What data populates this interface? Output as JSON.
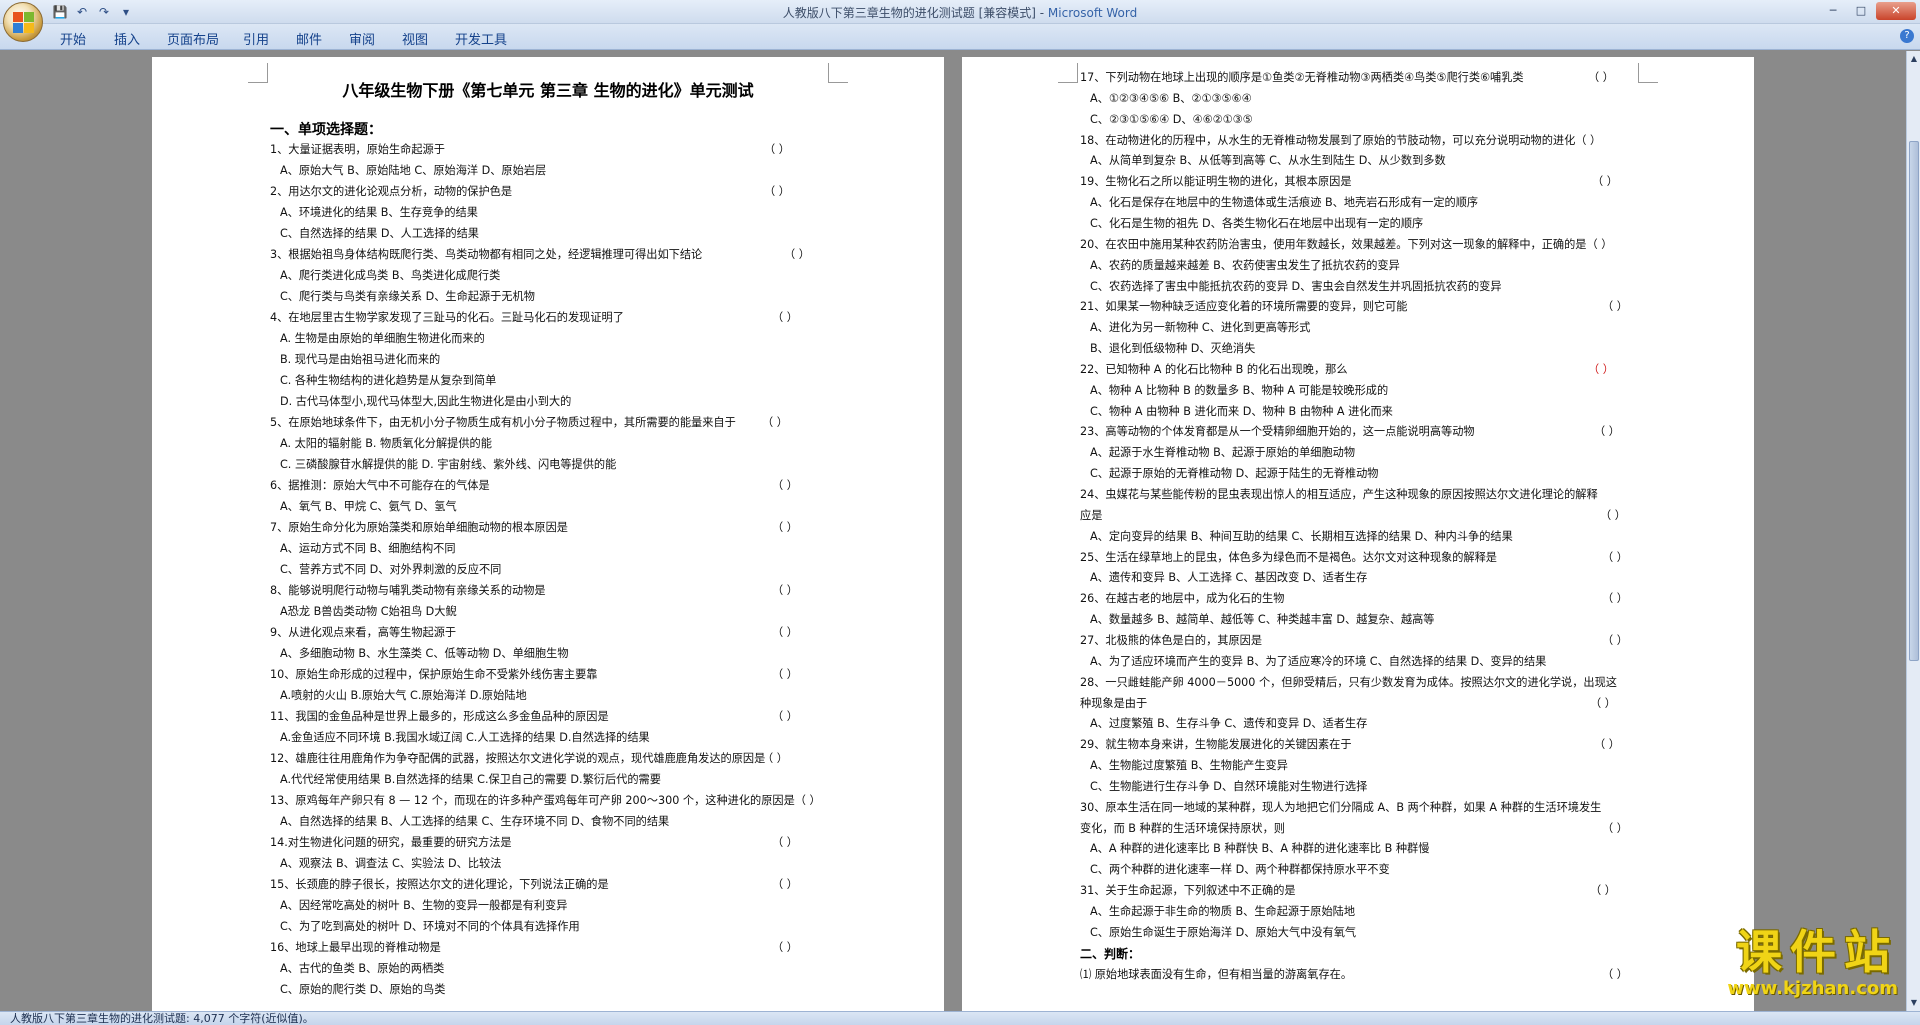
{
  "window": {
    "title_doc": "人教版八下第三章生物的进化测试题 [兼容模式] - ",
    "title_app": "Microsoft Word"
  },
  "quick_access": {
    "save": "💾",
    "undo": "↶",
    "redo": "↷",
    "more": "▾"
  },
  "window_controls": {
    "minimize": "─",
    "maximize": "□",
    "close": "✕"
  },
  "ribbon_tabs": [
    "开始",
    "插入",
    "页面布局",
    "引用",
    "邮件",
    "审阅",
    "视图",
    "开发工具"
  ],
  "help": "?",
  "left_page": {
    "title": "八年级生物下册《第七单元 第三章 生物的进化》单元测试",
    "section1": "一、单项选择题：",
    "lines": [
      "1、大量证据表明，原始生命起源于",
      "A、原始大气    B、原始陆地    C、原始海洋    D、原始岩层",
      "2、用达尔文的进化论观点分析，动物的保护色是",
      "A、环境进化的结果                B、生存竞争的结果",
      "C、自然选择的结果                D、人工选择的结果",
      "3、根据始祖鸟身体结构既爬行类、鸟类动物都有相同之处，经逻辑推理可得出如下结论",
      "A、爬行类进化成鸟类                B、鸟类进化成爬行类",
      "C、爬行类与鸟类有亲缘关系                D、生命起源于无机物",
      "4、在地层里古生物学家发现了三趾马的化石。三趾马化石的发现证明了",
      "A. 生物是由原始的单细胞生物进化而来的",
      "B. 现代马是由始祖马进化而来的",
      "C. 各种生物结构的进化趋势是从复杂到简单",
      "D. 古代马体型小,现代马体型大,因此生物进化是由小到大的",
      "5、在原始地球条件下，由无机小分子物质生成有机小分子物质过程中，其所需要的能量来自于",
      "A. 太阳的辐射能                B. 物质氧化分解提供的能",
      "C. 三磷酸腺苷水解提供的能                D. 宇宙射线、紫外线、闪电等提供的能",
      "6、据推测：原始大气中不可能存在的气体是",
      "A、氧气     B、甲烷     C、氨气     D、氢气",
      "7、原始生命分化为原始藻类和原始单细胞动物的根本原因是",
      "A、运动方式不同                B、细胞结构不同",
      "C、营养方式不同                D、对外界刺激的反应不同",
      "8、能够说明爬行动物与哺乳类动物有亲缘关系的动物是",
      "A恐龙      B兽齿类动物      C始祖鸟      D大鲵",
      "9、从进化观点来看，高等生物起源于",
      "A、多细胞动物        B、水生藻类        C、低等动物        D、单细胞生物",
      "10、原始生命形成的过程中，保护原始生命不受紫外线伤害主要靠",
      "A.喷射的火山      B.原始大气      C.原始海洋      D.原始陆地",
      "11、我国的金鱼品种是世界上最多的，形成这么多金鱼品种的原因是",
      "A.金鱼适应不同环境        B.我国水域辽阔        C.人工选择的结果        D.自然选择的结果",
      "12、雄鹿往往用鹿角作为争夺配偶的武器，按照达尔文进化学说的观点，现代雄鹿鹿角发达的原因是",
      "A.代代经常使用结果        B.自然选择的结果        C.保卫自己的需要        D.繁衍后代的需要",
      "13、原鸡每年产卵只有 8 — 12 个，而现在的许多种产蛋鸡每年可产卵 200～300 个，这种进化的原因是（   ）",
      "A、自然选择的结果      B、人工选择的结果      C、生存环境不同      D、食物不同的结果",
      "14.对生物进化问题的研究，最重要的研究方法是",
      "A、观察法        B、调查法        C、实验法        D、比较法",
      "15、长颈鹿的脖子很长，按照达尔文的进化理论，下列说法正确的是",
      "A、因经常吃高处的树叶                B、生物的变异一般都是有利变异",
      "C、为了吃到高处的树叶                D、环境对不同的个体具有选择作用",
      "16、地球上最早出现的脊椎动物是",
      "A、古代的鱼类                B、原始的两栖类",
      "C、原始的爬行类                D、原始的鸟类"
    ],
    "parens": [
      "（      ）",
      "（      ）",
      "（      ）",
      "（      ）",
      "（      ）",
      "（      ）",
      "（      ）",
      "（      ）",
      "（      ）",
      "（      ）",
      "（      ）",
      "（      ）",
      "（      ）",
      "（      ）",
      "（      ）"
    ]
  },
  "right_page": {
    "lines": [
      "17、下列动物在地球上出现的顺序是①鱼类②无脊椎动物③两栖类④鸟类⑤爬行类⑥哺乳类",
      "A、①②③④⑤⑥        B、②①③⑤⑥④",
      "C、②③①⑤⑥④        D、④⑥②①③⑤",
      "18、在动物进化的历程中，从水生的无脊椎动物发展到了原始的节肢动物，可以充分说明动物的进化（ ）",
      "A、从简单到复杂      B、从低等到高等      C、从水生到陆生      D、从少数到多数",
      "19、生物化石之所以能证明生物的进化，其根本原因是",
      "A、化石是保存在地层中的生物遗体或生活痕迹        B、地壳岩石形成有一定的顺序",
      "C、化石是生物的祖先                D、各类生物化石在地层中出现有一定的顺序",
      "20、在农田中施用某种农药防治害虫，使用年数越长，效果越差。下列对这一现象的解释中，正确的是（ ）",
      "A、农药的质量越来越差                B、农药使害虫发生了抵抗农药的变异",
      "C、农药选择了害虫中能抵抗农药的变异        D、害虫会自然发生并巩固抵抗农药的变异",
      "21、如果某一物种缺乏适应变化着的环境所需要的变异，则它可能",
      "A、进化为另一新物种                C、进化到更高等形式",
      "B、退化到低级物种                D、灭绝消失",
      "22、已知物种 A 的化石比物种 B 的化石出现晚，那么",
      "A、物种 A 比物种 B 的数量多        B、物种 A 可能是较晚形成的",
      "C、物种 A 由物种 B 进化而来        D、物种 B 由物种 A 进化而来",
      "23、高等动物的个体发育都是从一个受精卵细胞开始的，这一点能说明高等动物",
      "A、起源于水生脊椎动物                B、起源于原始的单细胞动物",
      "C、起源于原始的无脊椎动物        D、起源于陆生的无脊椎动物",
      "24、虫媒花与某些能传粉的昆虫表现出惊人的相互适应，产生这种现象的原因按照达尔文进化理论的解释",
      "应是",
      "A、定向变异的结果    B、种间互助的结果    C、长期相互选择的结果    D、种内斗争的结果",
      "25、生活在绿草地上的昆虫，体色多为绿色而不是褐色。达尔文对这种现象的解释是",
      "A、遗传和变异        B、人工选择        C、基因改变        D、适者生存",
      "26、在越古老的地层中，成为化石的生物",
      "A、数量越多        B、越简单、越低等        C、种类越丰富        D、越复杂、越高等",
      "27、北极熊的体色是白的，其原因是",
      "A、为了适应环境而产生的变异 B、为了适应寒冷的环境 C、自然选择的结果      D、变异的结果",
      "28、一只雌蛙能产卵 4000－5000 个，但卵受精后，只有少数发育为成体。按照达尔文的进化学说，出现这",
      "种现象是由于",
      "A、过度繁殖        B、生存斗争        C、遗传和变异        D、适者生存",
      "29、就生物本身来讲，生物能发展进化的关键因素在于",
      "A、生物能过度繁殖                B、生物能产生变异",
      "C、生物能进行生存斗争        D、自然环境能对生物进行选择",
      "30、原本生活在同一地域的某种群，现人为地把它们分隔成 A、B 两个种群，如果 A 种群的生活环境发生",
      "变化，而 B 种群的生活环境保持原状，则",
      "A、A 种群的进化速率比 B 种群快                B、A 种群的进化速率比 B 种群慢",
      "C、两个种群的进化速率一样                D、两个种群都保持原水平不变",
      "31、关于生命起源，下列叙述中不正确的是",
      "A、生命起源于非生命的物质                B、生命起源于原始陆地",
      "C、原始生命诞生于原始海洋                D、原始大气中没有氧气",
      "二、判断：",
      "⑴ 原始地球表面没有生命，但有相当量的游离氧存在。"
    ],
    "parens": [
      "（      ）",
      "（      ）",
      "（      ）",
      "（      ）",
      "（      ）",
      "（      ）",
      "（      ）",
      "（      ）",
      "（      ）",
      "（      ）",
      "（      ）",
      "（      ）",
      "（      ）",
      "（      ）",
      "（      ）",
      "（      ）"
    ]
  },
  "status": {
    "text": "人教版八下第三章生物的进化测试题: 4,077 个字符(近似值)。"
  },
  "watermark": {
    "brand": "课件站",
    "url": "www.kjzhan.com"
  }
}
